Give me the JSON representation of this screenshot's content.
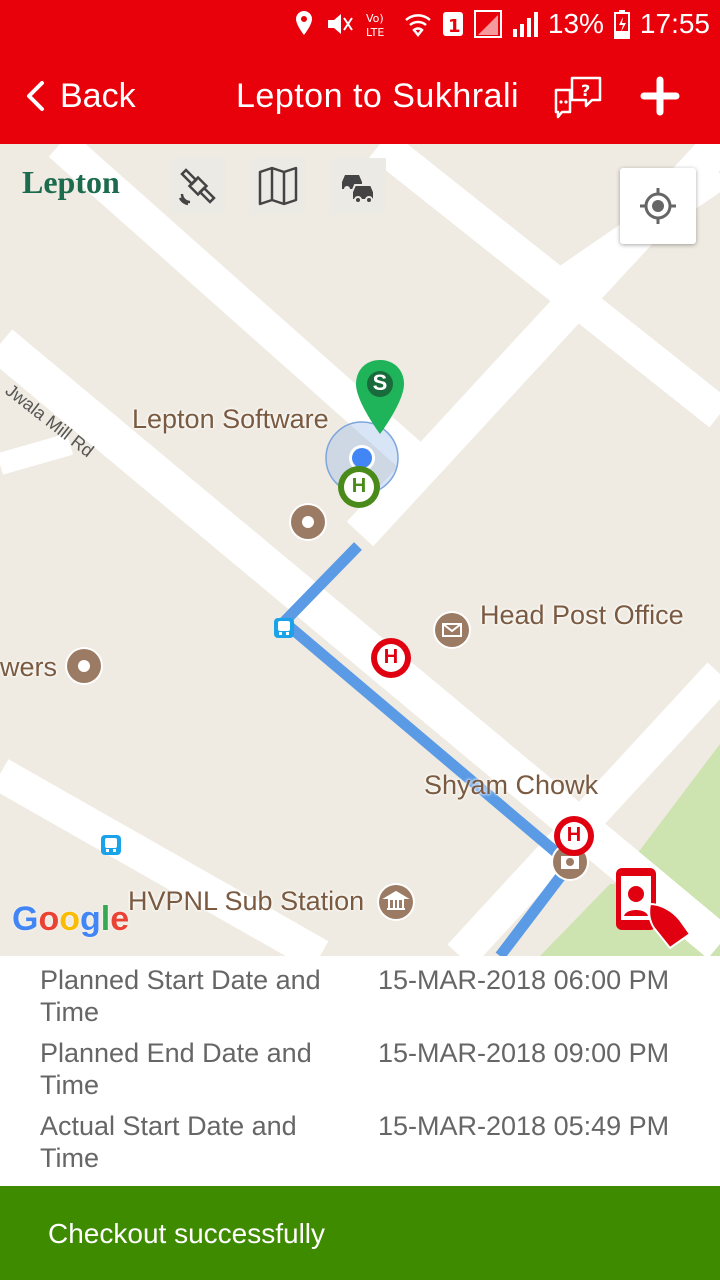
{
  "status_bar": {
    "battery": "13%",
    "time": "17:55"
  },
  "app_bar": {
    "back_label": "Back",
    "title": "Lepton to Sukhrali"
  },
  "map": {
    "logo_text": "Lepton",
    "labels": {
      "lepton_software": "Lepton Software",
      "jwala_mill_rd": "Jwala Mill Rd",
      "head_post_office": "Head Post Office",
      "towers": "wers",
      "shyam_chowk": "Shyam Chowk",
      "hvpnl": "HVPNL Sub Station"
    },
    "google_text": "Google",
    "start_marker": "S",
    "stop_marker": "H"
  },
  "details": [
    {
      "label": "Planned Start Date and Time",
      "value": "15-MAR-2018 06:00 PM"
    },
    {
      "label": "Planned End Date and Time",
      "value": "15-MAR-2018 09:00 PM"
    },
    {
      "label": "Actual Start Date and Time",
      "value": "15-MAR-2018 05:49 PM"
    }
  ],
  "snackbar": {
    "message": "Checkout successfully"
  },
  "colors": {
    "brand_red": "#e8000a",
    "success_green": "#3e8b00",
    "route_blue": "#5b9be6"
  }
}
